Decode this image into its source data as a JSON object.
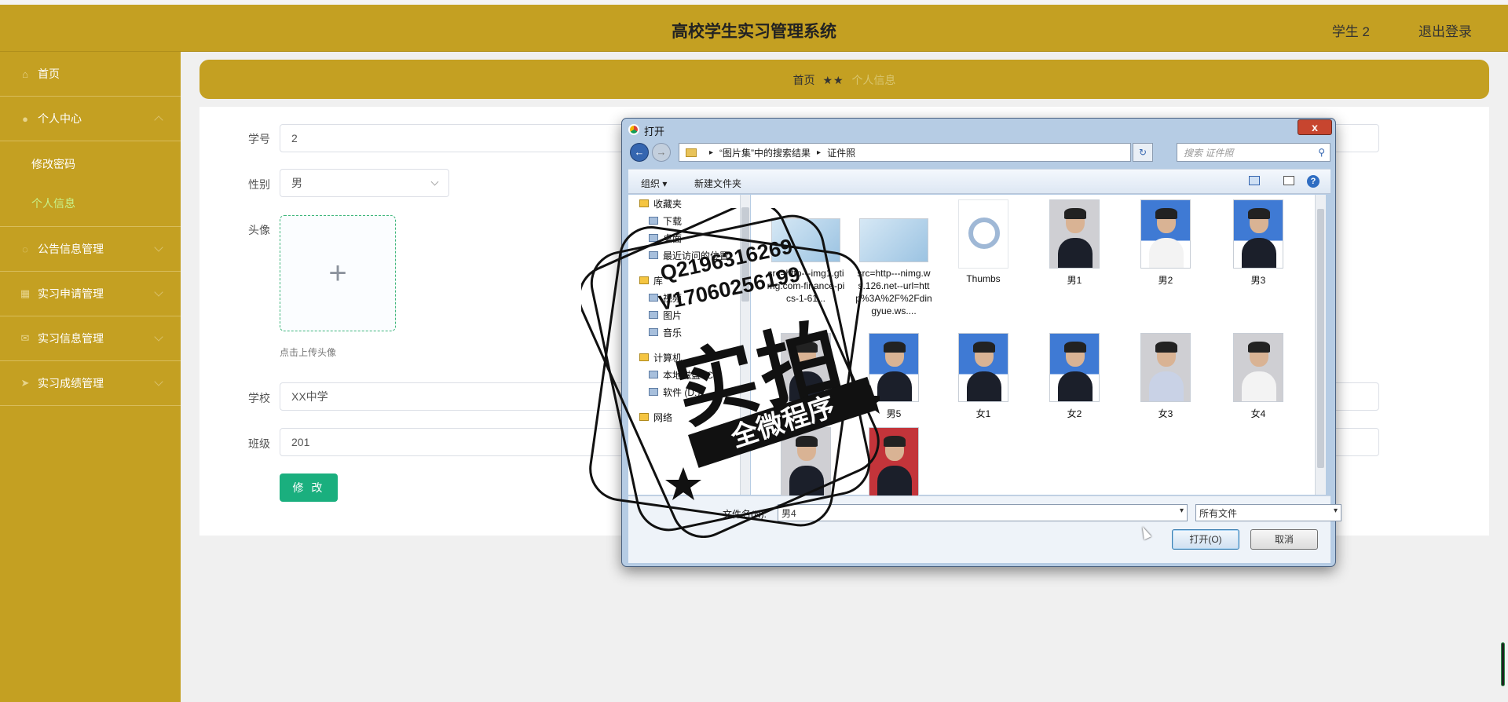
{
  "header": {
    "title": "高校学生实习管理系统",
    "user": "学生 2",
    "logout": "退出登录"
  },
  "sidebar": {
    "items": [
      {
        "label": "首页",
        "icon": "home-icon"
      },
      {
        "label": "个人中心",
        "icon": "user-icon"
      },
      {
        "label": "公告信息管理",
        "icon": "notice-icon"
      },
      {
        "label": "实习申请管理",
        "icon": "grid-icon"
      },
      {
        "label": "实习信息管理",
        "icon": "mail-icon"
      },
      {
        "label": "实习成绩管理",
        "icon": "send-icon"
      }
    ],
    "submenu": [
      {
        "label": "修改密码"
      },
      {
        "label": "个人信息"
      }
    ]
  },
  "breadcrumb": {
    "home": "首页",
    "sep": "★★",
    "current": "个人信息"
  },
  "form": {
    "student_no_label": "学号",
    "student_no": "2",
    "gender_label": "性别",
    "gender": "男",
    "avatar_label": "头像",
    "upload_plus": "+",
    "upload_tip": "点击上传头像",
    "school_label": "学校",
    "school": "XX中学",
    "class_label": "班级",
    "class": "201",
    "submit": "修 改"
  },
  "dialog": {
    "title": "打开",
    "close": "x",
    "back": "←",
    "forward": "→",
    "path": [
      "“图片集”中的搜索结果",
      "证件照"
    ],
    "path_chev": "▸",
    "refresh": "↻",
    "search_placeholder": "搜索 证件照",
    "search_icon": "⚲",
    "organize": "组织 ▾",
    "new_folder": "新建文件夹",
    "help": "?",
    "tree": [
      {
        "label": "收藏夹",
        "group": true
      },
      {
        "label": "下载"
      },
      {
        "label": "桌面"
      },
      {
        "label": "最近访问的位置"
      },
      {
        "label": "库",
        "group": true
      },
      {
        "label": "视频"
      },
      {
        "label": "图片"
      },
      {
        "label": "音乐"
      },
      {
        "label": "计算机",
        "group": true
      },
      {
        "label": "本地磁盘 (C:)"
      },
      {
        "label": "软件 (D:)"
      },
      {
        "label": "网络",
        "group": true
      }
    ],
    "files": [
      {
        "name": "src=http---img1.gtimg.com-finance-pics-1-61...",
        "kind": "card"
      },
      {
        "name": "src=http---nimg.ws.126.net--url=http%3A%2F%2Fdingyue.ws....",
        "kind": "card"
      },
      {
        "name": "Thumbs",
        "kind": "gear"
      },
      {
        "name": "男1",
        "kind": "grey"
      },
      {
        "name": "男2",
        "kind": "blue"
      },
      {
        "name": "男3",
        "kind": "blue"
      },
      {
        "name": "男4",
        "kind": "grey"
      },
      {
        "name": "男5",
        "kind": "blue"
      },
      {
        "name": "女1",
        "kind": "blue"
      },
      {
        "name": "女2",
        "kind": "blue"
      },
      {
        "name": "女3",
        "kind": "grey"
      },
      {
        "name": "女4",
        "kind": "grey"
      },
      {
        "name": "",
        "kind": "grey"
      },
      {
        "name": "",
        "kind": "red"
      }
    ],
    "filename_label": "文件名(N):",
    "filename": "男4",
    "filetype": "所有文件",
    "dropdown_caret": "▾",
    "open_button": "打开(O)",
    "cancel_button": "取消"
  },
  "watermark": {
    "qq1": "Q2196316269",
    "qq2": "V17060256199",
    "big": "实拍",
    "banner": "全微程序"
  }
}
